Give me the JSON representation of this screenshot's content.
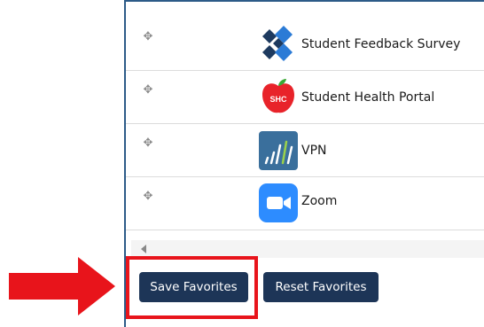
{
  "favorites": [
    {
      "label": "Student Feedback Survey",
      "icon": "feedback-survey-logo-icon"
    },
    {
      "label": "Student Health Portal",
      "icon": "apple-shc-logo-icon",
      "icon_text": "SHC"
    },
    {
      "label": "VPN",
      "icon": "vpn-logo-icon"
    },
    {
      "label": "Zoom",
      "icon": "zoom-camera-icon"
    }
  ],
  "buttons": {
    "save_label": "Save Favorites",
    "reset_label": "Reset Favorites"
  },
  "colors": {
    "button_bg": "#1d3557",
    "highlight": "#e8141b",
    "arrow": "#e8141b",
    "zoom_blue": "#2d8cff",
    "apple_red": "#e8232a",
    "survey_dark": "#1e3a5f",
    "survey_light": "#2b7bd6"
  }
}
